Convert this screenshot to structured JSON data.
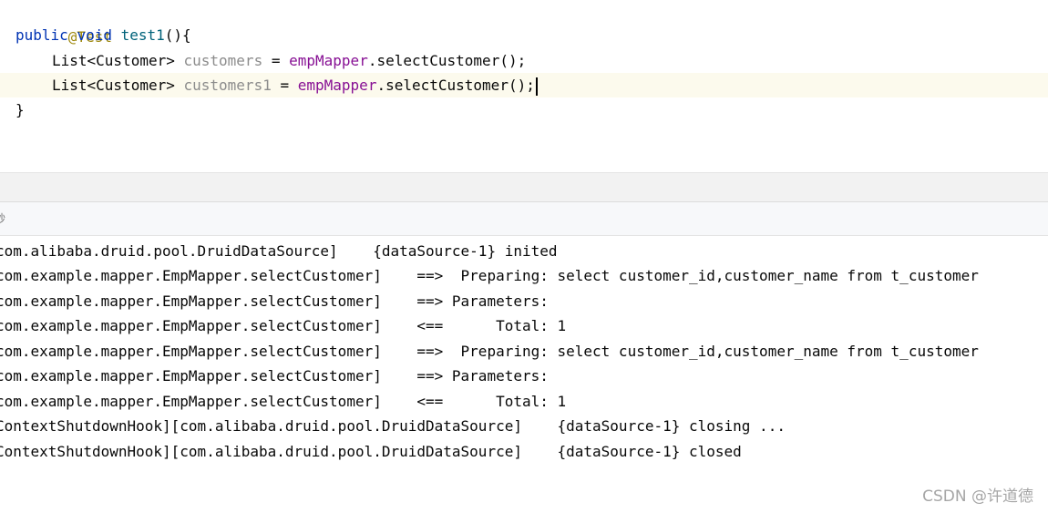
{
  "editor": {
    "line1": {
      "annotation": "@Test"
    },
    "line2": {
      "kw_public": "public",
      "kw_void": "void",
      "method_name": "test1",
      "punct": "(){"
    },
    "line3": {
      "type": "List<Customer>",
      "var_name": "customers",
      "assign": "=",
      "field": "empMapper",
      "call": ".selectCustomer();"
    },
    "line4": {
      "type": "List<Customer>",
      "var_name": "customers1",
      "assign": "=",
      "field": "empMapper",
      "call": ".selectCustomer();"
    },
    "line5": {
      "close_brace": "}"
    }
  },
  "console_header": {
    "label": "秒"
  },
  "console": {
    "lines": [
      "com.alibaba.druid.pool.DruidDataSource]    {dataSource-1} inited",
      "com.example.mapper.EmpMapper.selectCustomer]    ==>  Preparing: select customer_id,customer_name from t_customer",
      "com.example.mapper.EmpMapper.selectCustomer]    ==> Parameters: ",
      "com.example.mapper.EmpMapper.selectCustomer]    <==      Total: 1",
      "com.example.mapper.EmpMapper.selectCustomer]    ==>  Preparing: select customer_id,customer_name from t_customer",
      "com.example.mapper.EmpMapper.selectCustomer]    ==> Parameters: ",
      "com.example.mapper.EmpMapper.selectCustomer]    <==      Total: 1",
      "ContextShutdownHook][com.alibaba.druid.pool.DruidDataSource]    {dataSource-1} closing ...",
      "ContextShutdownHook][com.alibaba.druid.pool.DruidDataSource]    {dataSource-1} closed"
    ]
  },
  "watermark": "CSDN @许道德",
  "colors": {
    "annotation": "#9e880d",
    "keyword": "#0033b3",
    "method_declaration": "#00627a",
    "unused_variable": "#8c8c8c",
    "field": "#871094",
    "current_line_highlight": "#fcfaed"
  }
}
